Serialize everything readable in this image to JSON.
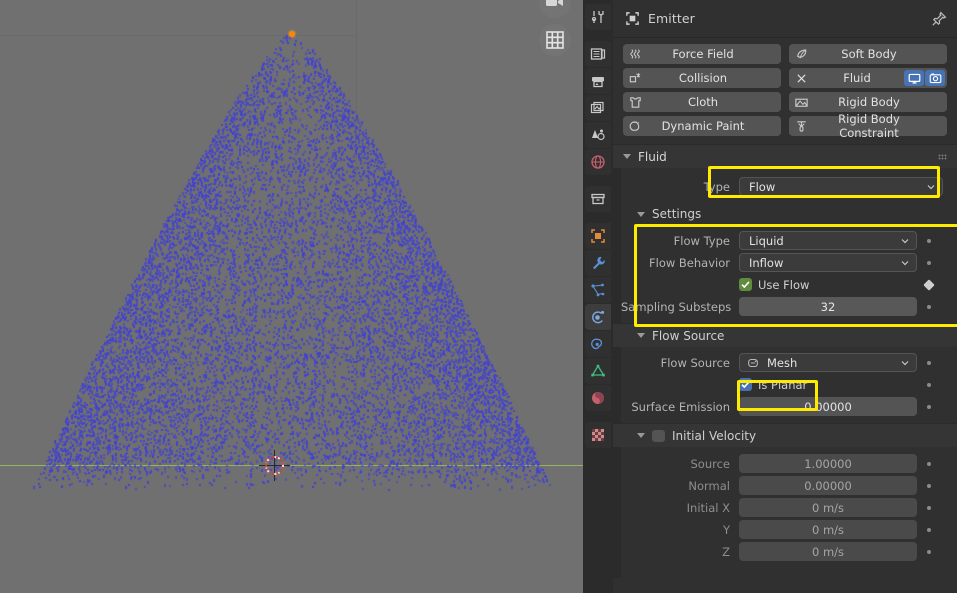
{
  "app": "Blender",
  "viewport": {
    "name": "3d-viewport",
    "background_color": "#707070",
    "particle_color": "#3f3fd6",
    "origin_color": "#ff8400",
    "y_axis_color": "#9cbf5a",
    "gizmos": [
      {
        "name": "camera-view-gizmo",
        "icon": "camera-icon"
      },
      {
        "name": "grid-toggle-gizmo",
        "icon": "grid-icon"
      }
    ]
  },
  "tab_rail": {
    "tabs": [
      {
        "name": "tool",
        "icon": "tool-icon",
        "active": false,
        "color": "#c8c8c8"
      },
      {
        "name": "render",
        "icon": "camera-back-icon",
        "active": false,
        "color": "#c8c8c8"
      },
      {
        "name": "output",
        "icon": "printer-icon",
        "active": false,
        "color": "#c8c8c8"
      },
      {
        "name": "view-layer",
        "icon": "images-icon",
        "active": false,
        "color": "#c8c8c8"
      },
      {
        "name": "scene",
        "icon": "scene-cone-icon",
        "active": false,
        "color": "#c8c8c8"
      },
      {
        "name": "world",
        "icon": "world-globe-icon",
        "active": false,
        "color": "#c4616e"
      },
      {
        "name": "collection",
        "icon": "collection-box-icon",
        "active": false,
        "color": "#c8c8c8"
      },
      {
        "name": "object",
        "icon": "object-square-icon",
        "active": false,
        "color": "#e08a3c"
      },
      {
        "name": "modifiers",
        "icon": "wrench-icon",
        "active": false,
        "color": "#5b8fd6"
      },
      {
        "name": "particles",
        "icon": "particles-icon",
        "active": false,
        "color": "#5b8fd6"
      },
      {
        "name": "physics",
        "icon": "physics-orbit-icon",
        "active": true,
        "color": "#7fa9e0"
      },
      {
        "name": "object-constraints",
        "icon": "constraint-icon",
        "active": false,
        "color": "#5b8fd6"
      },
      {
        "name": "object-data",
        "icon": "mesh-data-icon",
        "active": false,
        "color": "#3fbf7f"
      },
      {
        "name": "material",
        "icon": "material-sphere-icon",
        "active": false,
        "color": "#c4616e"
      },
      {
        "name": "texture",
        "icon": "checker-texture-icon",
        "active": false,
        "color": "#d08a8a"
      }
    ]
  },
  "properties": {
    "header": {
      "breadcrumb_icon": "object-icon",
      "breadcrumb_label": "Emitter",
      "pin_icon": "pin-icon"
    },
    "physics_buttons": [
      {
        "name": "force-field-button",
        "label": "Force Field",
        "icon": "force-field-icon",
        "enabled": false
      },
      {
        "name": "soft-body-button",
        "label": "Soft Body",
        "icon": "soft-body-icon",
        "enabled": false
      },
      {
        "name": "collision-button",
        "label": "Collision",
        "icon": "collision-icon",
        "enabled": false
      },
      {
        "name": "fluid-button",
        "label": "Fluid",
        "icon": "close-x-icon",
        "enabled": true,
        "toggles": [
          {
            "name": "fluid-viewport-toggle",
            "icon": "monitor-icon",
            "active": true
          },
          {
            "name": "fluid-render-toggle",
            "icon": "camera-icon",
            "active": true
          }
        ]
      },
      {
        "name": "cloth-button",
        "label": "Cloth",
        "icon": "cloth-icon",
        "enabled": false
      },
      {
        "name": "rigid-body-button",
        "label": "Rigid Body",
        "icon": "rigid-body-icon",
        "enabled": false
      },
      {
        "name": "dynamic-paint-button",
        "label": "Dynamic Paint",
        "icon": "dynamic-paint-icon",
        "enabled": false
      },
      {
        "name": "rigid-body-constraint-button",
        "label": "Rigid Body Constraint",
        "icon": "rbd-constraint-icon",
        "enabled": false
      }
    ],
    "fluid_panel": {
      "title": "Fluid",
      "type_row": {
        "label": "Type",
        "value": "Flow",
        "highlighted": true
      }
    },
    "settings_panel": {
      "title": "Settings",
      "highlighted": true,
      "flow_type": {
        "label": "Flow Type",
        "value": "Liquid"
      },
      "flow_behavior": {
        "label": "Flow Behavior",
        "value": "Inflow"
      },
      "use_flow": {
        "label": "Use Flow",
        "checked": true,
        "decorator": "diamond"
      },
      "sampling_substeps": {
        "label": "Sampling Substeps",
        "value": "32"
      }
    },
    "flow_source_panel": {
      "title": "Flow Source",
      "flow_source": {
        "label": "Flow Source",
        "value": "Mesh",
        "icon": "mesh-data-icon"
      },
      "is_planar": {
        "label": "Is Planar",
        "checked": true,
        "highlighted": true
      },
      "surface_emission": {
        "label": "Surface Emission",
        "value": "0.00000"
      }
    },
    "initial_velocity_panel": {
      "title": "Initial Velocity",
      "enabled": false,
      "rows": [
        {
          "label": "Source",
          "value": "1.00000"
        },
        {
          "label": "Normal",
          "value": "0.00000"
        },
        {
          "label": "Initial X",
          "value": "0 m/s"
        },
        {
          "label": "Y",
          "value": "0 m/s"
        },
        {
          "label": "Z",
          "value": "0 m/s"
        }
      ]
    }
  },
  "highlight_color": "#ffeb00"
}
